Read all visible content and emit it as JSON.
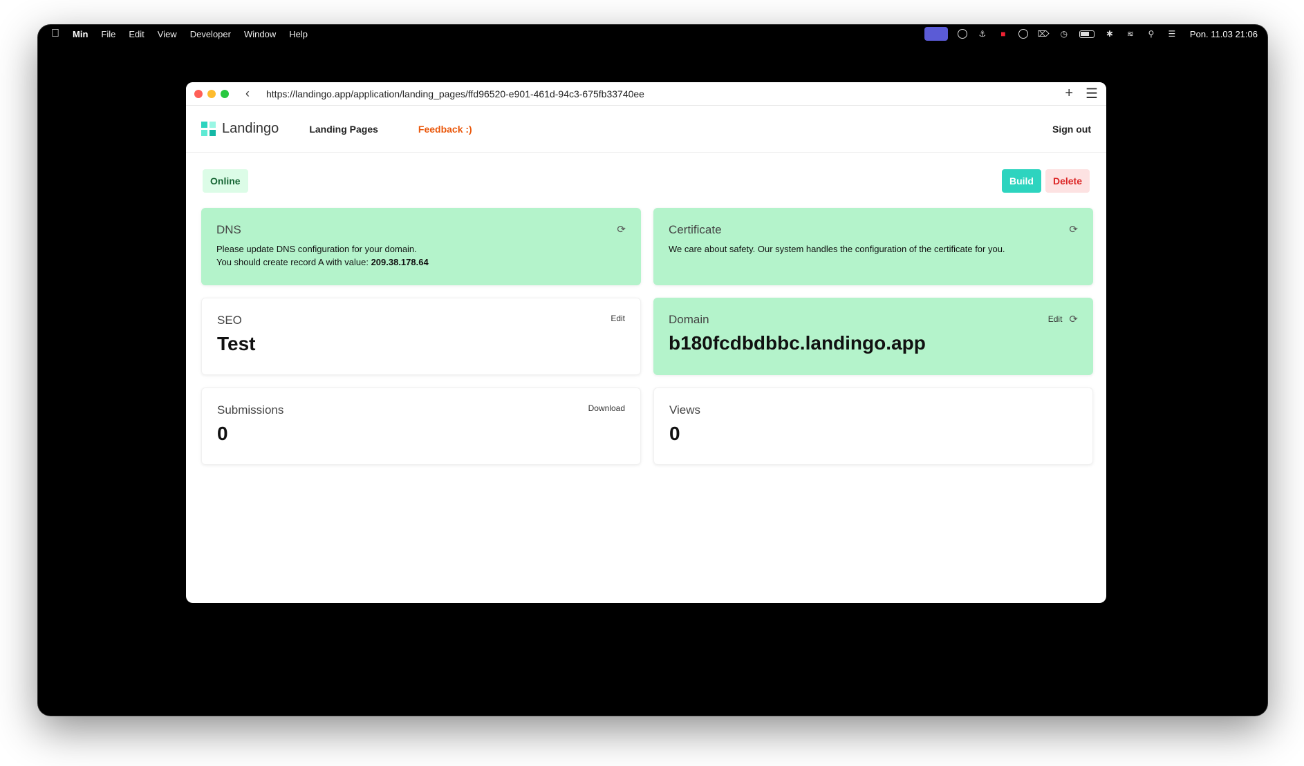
{
  "menubar": {
    "app_name": "Min",
    "items": [
      "File",
      "Edit",
      "View",
      "Developer",
      "Window",
      "Help"
    ],
    "clock": "Pon. 11.03  21:06"
  },
  "browser": {
    "url": "https://landingo.app/application/landing_pages/ffd96520-e901-461d-94c3-675fb33740ee"
  },
  "nav": {
    "logo_text": "Landingo",
    "landing_pages": "Landing Pages",
    "feedback": "Feedback :)",
    "sign_out": "Sign out"
  },
  "status": {
    "badge": "Online",
    "build_label": "Build",
    "delete_label": "Delete"
  },
  "cards": {
    "dns": {
      "title": "DNS",
      "line1": "Please update DNS configuration for your domain.",
      "line2_prefix": "You should create record A with value: ",
      "ip": "209.38.178.64"
    },
    "certificate": {
      "title": "Certificate",
      "text": "We care about safety. Our system handles the configuration of the certificate for you."
    },
    "seo": {
      "title": "SEO",
      "value": "Test",
      "edit_label": "Edit"
    },
    "domain": {
      "title": "Domain",
      "value": "b180fcdbdbbc.landingo.app",
      "edit_label": "Edit"
    },
    "submissions": {
      "title": "Submissions",
      "value": "0",
      "download_label": "Download"
    },
    "views": {
      "title": "Views",
      "value": "0"
    }
  },
  "colors": {
    "card_green": "#b4f3cb",
    "build": "#2dd4bf",
    "delete_bg": "#fde2e2",
    "delete_text": "#dc2626",
    "feedback": "#ea580c"
  }
}
